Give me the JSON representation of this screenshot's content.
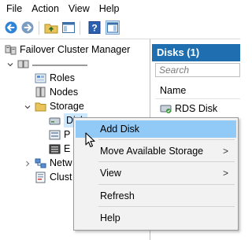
{
  "menubar": {
    "items": [
      "File",
      "Action",
      "View",
      "Help"
    ]
  },
  "tree": {
    "root_label": "Failover Cluster Manager",
    "roles_label": "Roles",
    "nodes_label": "Nodes",
    "storage_label": "Storage",
    "disks_label": "Disk",
    "pools_label": "P",
    "enclosures_label": "E",
    "networks_label": "Netw",
    "cluster_events_label": "Clust"
  },
  "right_pane": {
    "header": "Disks (1)",
    "search_placeholder": "Search",
    "column_name": "Name",
    "rows": [
      {
        "name": "RDS Disk"
      }
    ]
  },
  "context_menu": {
    "items": [
      {
        "label": "Add Disk",
        "highlighted": true,
        "submenu": false
      },
      {
        "label": "Move Available Storage",
        "highlighted": false,
        "submenu": true
      },
      {
        "label": "View",
        "highlighted": false,
        "submenu": true
      },
      {
        "label": "Refresh",
        "highlighted": false,
        "submenu": false
      },
      {
        "label": "Help",
        "highlighted": false,
        "submenu": false
      }
    ],
    "submenu_glyph": ">"
  },
  "colors": {
    "accent": "#1f6fb0",
    "menu_highlight": "#91c9f7",
    "tree_selection": "#cce8ff"
  }
}
